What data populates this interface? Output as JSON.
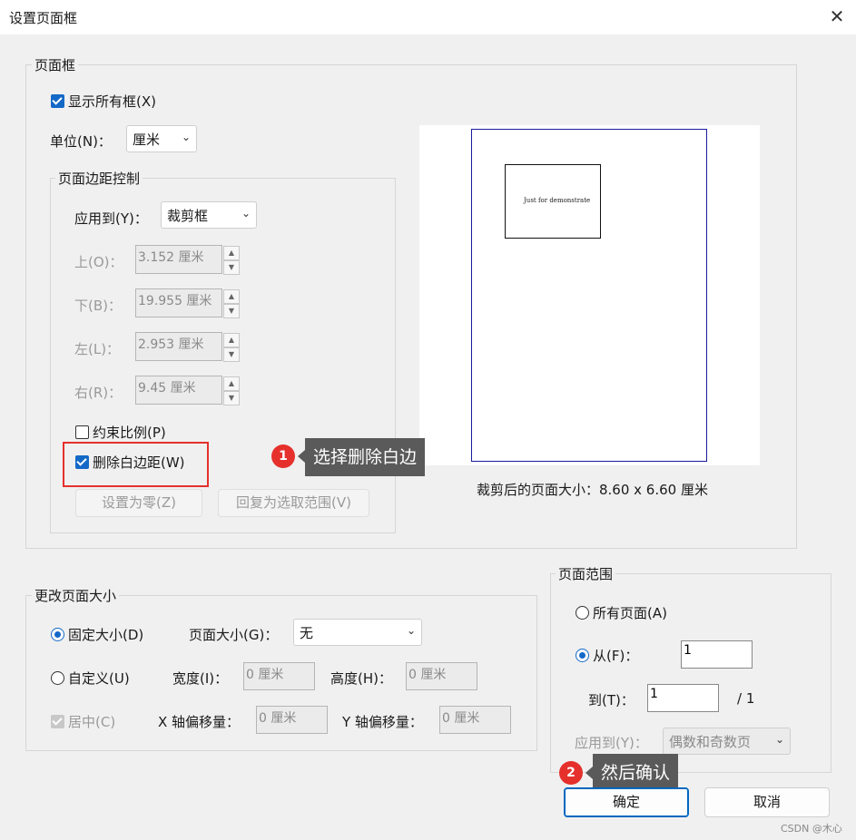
{
  "window": {
    "title": "设置页面框",
    "close_glyph": "✕"
  },
  "page_box": {
    "group_label": "页面框",
    "show_all_label": "显示所有框(X)",
    "unit_label": "单位(N)：",
    "unit_value": "厘米",
    "margin_group": {
      "label": "页面边距控制",
      "apply_label": "应用到(Y)：",
      "apply_value": "裁剪框",
      "rows": [
        {
          "label": "上(O)：",
          "value": "3.152 厘米"
        },
        {
          "label": "下(B)：",
          "value": "19.955 厘米"
        },
        {
          "label": "左(L)：",
          "value": "2.953 厘米"
        },
        {
          "label": "右(R)：",
          "value": "9.45 厘米"
        }
      ],
      "constrain_label": "约束比例(P)",
      "remove_white_label": "删除白边距(W)",
      "set_zero_label": "设置为零(Z)",
      "revert_label": "回复为选取范围(V)"
    },
    "preview": {
      "crop_text": "Just for demonstrate",
      "size_caption": "裁剪后的页面大小：8.60 x 6.60 厘米"
    }
  },
  "change_size": {
    "group_label": "更改页面大小",
    "fixed_label": "固定大小(D)",
    "page_size_label": "页面大小(G)：",
    "page_size_value": "无",
    "custom_label": "自定义(U)",
    "width_label": "宽度(I)：",
    "width_value": "0 厘米",
    "height_label": "高度(H)：",
    "height_value": "0 厘米",
    "center_label": "居中(C)",
    "xoffset_label": "X 轴偏移量：",
    "xoffset_value": "0 厘米",
    "yoffset_label": "Y 轴偏移量：",
    "yoffset_value": "0 厘米"
  },
  "page_range": {
    "group_label": "页面范围",
    "all_label": "所有页面(A)",
    "from_label": "从(F)：",
    "from_value": "1",
    "to_label": "到(T)：",
    "to_value": "1",
    "total": "/ 1",
    "apply_label": "应用到(Y)：",
    "apply_value": "偶数和奇数页"
  },
  "buttons": {
    "ok": "确定",
    "cancel": "取消"
  },
  "annotations": {
    "badge1": "1",
    "tip1": "选择删除白边",
    "badge2": "2",
    "tip2": "然后确认"
  },
  "watermark": "CSDN @木心",
  "colors": {
    "accent": "#1469c7",
    "highlight": "#e5302c",
    "tooltip": "#5a5a5a"
  }
}
